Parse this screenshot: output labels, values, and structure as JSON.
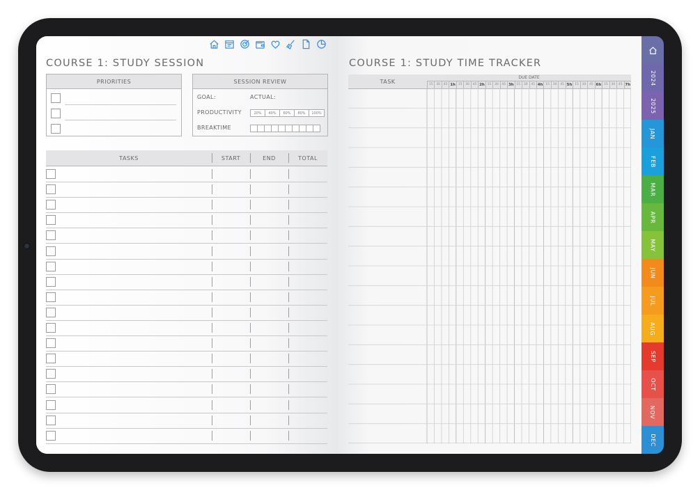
{
  "nav_icons": [
    "home-icon",
    "calendar-icon",
    "target-icon",
    "wallet-icon",
    "heart-icon",
    "broom-icon",
    "document-icon",
    "pie-chart-icon"
  ],
  "left": {
    "title": "COURSE 1: STUDY SESSION",
    "priorities": {
      "header": "PRIORITIES",
      "rows": 3
    },
    "review": {
      "header": "SESSION REVIEW",
      "goal": "GOAL:",
      "actual": "ACTUAL:",
      "productivity": "PRODUCTIVITY",
      "percents": [
        "20%",
        "40%",
        "60%",
        "80%",
        "100%"
      ],
      "breaktime": "BREAKTIME",
      "break_boxes": 10
    },
    "tasks": {
      "header": "TASKS",
      "start": "START",
      "end": "END",
      "total": "TOTAL",
      "rows": 18
    }
  },
  "right": {
    "title": "COURSE 1: STUDY TIME TRACKER",
    "task_header": "TASK",
    "due_date": "DUE DATE",
    "time_labels": [
      "15",
      "30",
      "45",
      "1h",
      "15",
      "30",
      "45",
      "2h",
      "15",
      "30",
      "45",
      "3h",
      "15",
      "30",
      "45",
      "4h",
      "15",
      "30",
      "45",
      "5h",
      "15",
      "30",
      "45",
      "6h",
      "15",
      "30",
      "45",
      "7h"
    ],
    "rows": 18
  },
  "tabs": [
    {
      "label": "home",
      "color": "#6a6fa8",
      "icon": "home-icon"
    },
    {
      "label": "2024",
      "color": "#7068ad"
    },
    {
      "label": "2025",
      "color": "#7b63b0"
    },
    {
      "label": "JAN",
      "color": "#2596d8"
    },
    {
      "label": "FEB",
      "color": "#1ba0dc"
    },
    {
      "label": "MAR",
      "color": "#4caf46"
    },
    {
      "label": "APR",
      "color": "#67b83c"
    },
    {
      "label": "MAY",
      "color": "#86c23a"
    },
    {
      "label": "JUN",
      "color": "#f28a1c"
    },
    {
      "label": "JUL",
      "color": "#f59c1e"
    },
    {
      "label": "AUG",
      "color": "#f6ad1c"
    },
    {
      "label": "SEP",
      "color": "#e53b2e"
    },
    {
      "label": "OCT",
      "color": "#e8514a"
    },
    {
      "label": "NOV",
      "color": "#e36860"
    },
    {
      "label": "DEC",
      "color": "#2f8fd5"
    }
  ]
}
